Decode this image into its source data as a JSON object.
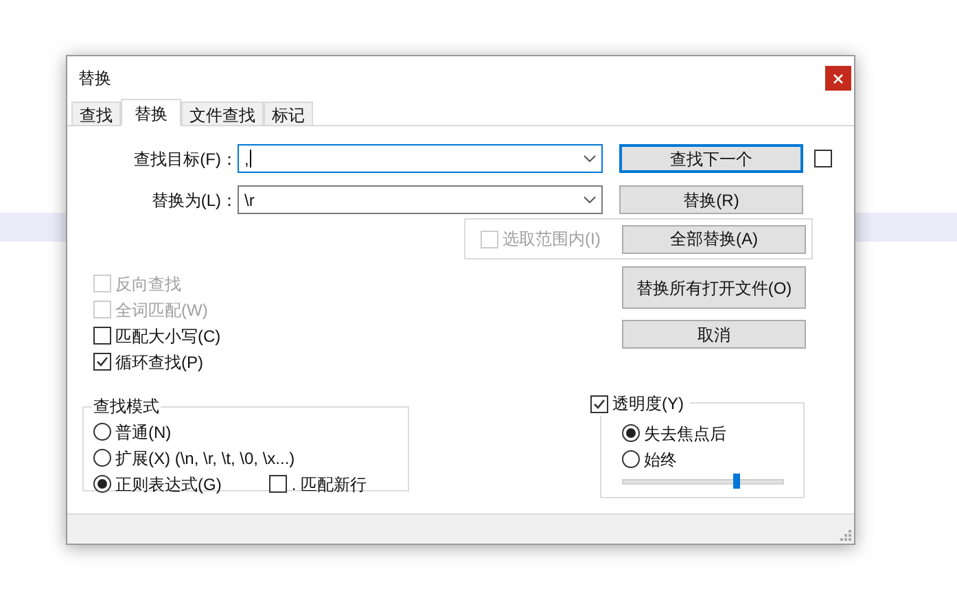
{
  "window": {
    "title": "替换"
  },
  "tabs": [
    {
      "label": "查找",
      "selected": false
    },
    {
      "label": "替换",
      "selected": true
    },
    {
      "label": "文件查找",
      "selected": false
    },
    {
      "label": "标记",
      "selected": false
    }
  ],
  "find": {
    "label": "查找目标(F)：",
    "value": ","
  },
  "replace": {
    "label": "替换为(L)：",
    "value": "\\r"
  },
  "extra_checkbox": {
    "checked": false
  },
  "in_selection": {
    "label": "选取范围内(I)",
    "checked": false,
    "disabled": true
  },
  "buttons": [
    {
      "label": "查找下一个",
      "focused": true
    },
    {
      "label": "替换(R)",
      "focused": false
    },
    {
      "label": "全部替换(A)",
      "focused": false
    },
    {
      "label": "替换所有打开文件(O)",
      "focused": false
    },
    {
      "label": "取消",
      "focused": false
    }
  ],
  "options": [
    {
      "label": "反向查找",
      "checked": false,
      "disabled": true
    },
    {
      "label": "全词匹配(W)",
      "checked": false,
      "disabled": true
    },
    {
      "label": "匹配大小写(C)",
      "checked": false,
      "disabled": false
    },
    {
      "label": "循环查找(P)",
      "checked": true,
      "disabled": false
    }
  ],
  "search_mode": {
    "title": "查找模式",
    "options": [
      {
        "label": "普通(N)",
        "selected": false
      },
      {
        "label": "扩展(X) (\\n, \\r, \\t, \\0, \\x...)",
        "selected": false
      },
      {
        "label": "正则表达式(G)",
        "selected": true
      }
    ],
    "dot_newline": {
      "label": ". 匹配新行",
      "checked": false
    }
  },
  "transparency": {
    "label": "透明度(Y)",
    "checked": true,
    "options": [
      {
        "label": "失去焦点后",
        "selected": true
      },
      {
        "label": "始终",
        "selected": false
      }
    ],
    "slider": {
      "level": 0.71
    }
  }
}
